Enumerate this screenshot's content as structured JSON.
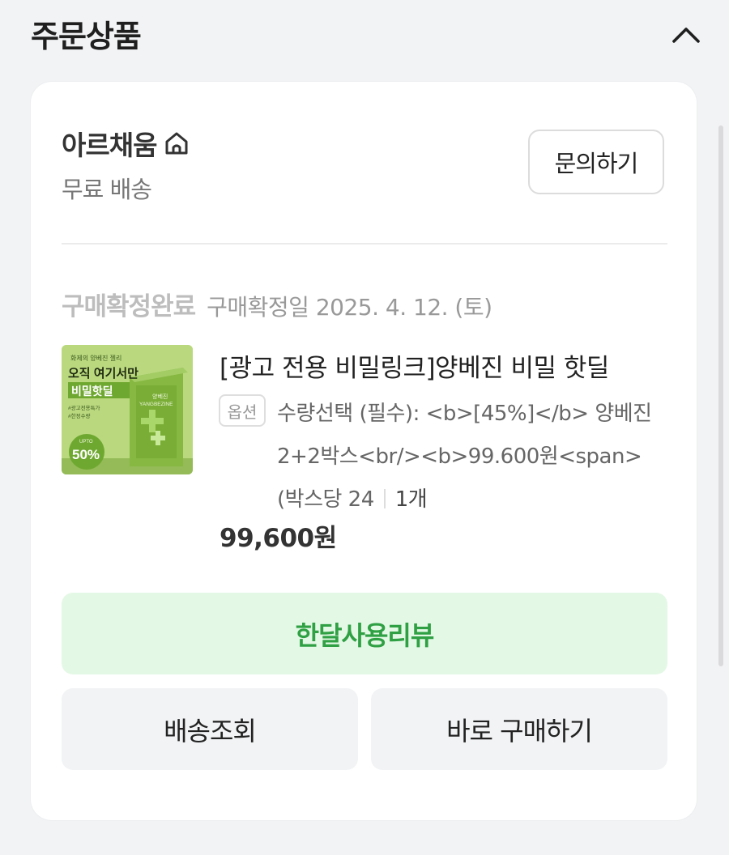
{
  "section": {
    "title": "주문상품"
  },
  "seller": {
    "name": "아르채움",
    "shipping": "무료 배송",
    "inquiry_label": "문의하기"
  },
  "order": {
    "status": "구매확정완료",
    "confirm_date": "구매확정일 2025. 4. 12. (토)"
  },
  "product": {
    "name": "[광고 전용 비밀링크]양베진 비밀 핫딜",
    "option_badge": "옵션",
    "option_text": "수량선택 (필수): <b>[45%]</b> 양베진 2+2박스<br/><b>99.600원<span>(박스당 24",
    "quantity": "1개",
    "price": "99,600원",
    "thumbnail": {
      "top_text": "화제의 양베진 젤리",
      "headline": "오직 여기서만",
      "deal": "비밀핫딜",
      "tags": [
        "#광고전용특가",
        "#한정수량"
      ],
      "upto": "UPTO",
      "percent": "50%",
      "box_brand": "양베진",
      "box_brand_en": "YANGBEZINE"
    }
  },
  "actions": {
    "review_label": "한달사용리뷰",
    "track_label": "배송조회",
    "buy_again_label": "바로 구매하기"
  },
  "colors": {
    "accent_green": "#2fa043",
    "review_bg": "#e4f8e6",
    "page_bg": "#f2f3f5"
  }
}
